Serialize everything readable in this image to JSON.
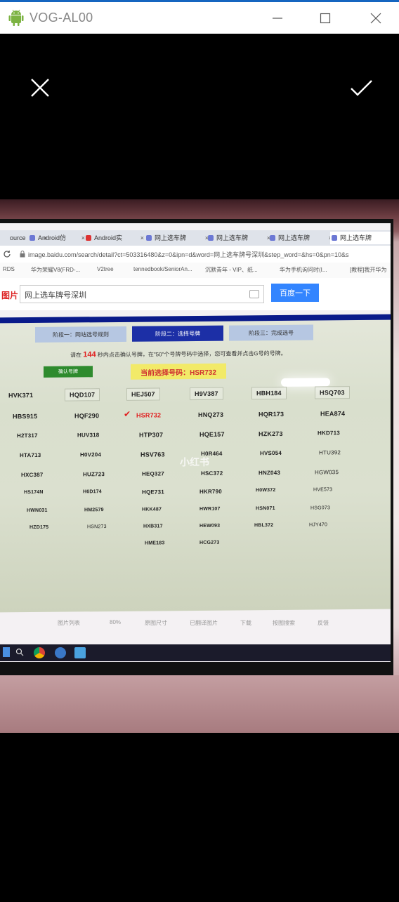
{
  "window": {
    "title": "VOG-AL00",
    "accent_color": "#1565c0",
    "app_icon": "android-icon"
  },
  "camera": {
    "cancel_icon": "close-icon",
    "confirm_icon": "check-icon"
  },
  "browser": {
    "tabs": [
      {
        "label": "ource"
      },
      {
        "label": "Android仿"
      },
      {
        "label": "Android实"
      },
      {
        "label": "网上选车牌"
      },
      {
        "label": "网上选车牌"
      },
      {
        "label": "网上选车牌"
      },
      {
        "label": "网上选车牌"
      }
    ],
    "address": "image.baidu.com/search/detail?ct=503316480&z=0&ipn=d&word=网上选车牌号深圳&step_word=&hs=0&pn=10&s",
    "bookmarks": [
      "RDS",
      "华为荣耀V8(FRD-...",
      "V2tree",
      "tennedbook/SeniorAn...",
      "沉默青年 - VIP、纸...",
      "华为手机询问时(I...",
      "[教程]我开华为"
    ],
    "logo": "图片",
    "search_value": "网上选车牌号深圳",
    "search_button": "百度一下"
  },
  "photo_page": {
    "steps": [
      "阶段一：网站选号规则",
      "阶段二：选择号牌",
      "阶段三：完成选号"
    ],
    "notice_prefix": "请在",
    "notice_count": "144",
    "notice_suffix": "秒内点击确认号牌，在\"50\"个号牌号码中选择，您可查看并点击G号的号牌。",
    "confirm_label": "确认号牌",
    "current_plate": "当前选择号码：HSR732",
    "watermark": "小红书",
    "plates_row1": [
      "HVK371",
      "HQD107",
      "HEJ507",
      "H9V387",
      "HBH184",
      "HSQ703"
    ],
    "plates_row2": [
      "HBS915",
      "HQF290",
      "HSR732",
      "HNQ273",
      "HQR173",
      "HEA874"
    ],
    "plates_row3": [
      "H2T317",
      "HUV318",
      "HTP307",
      "HQE157",
      "HZK273",
      "HKD713"
    ],
    "plates_row4": [
      "HTA713",
      "H0V204",
      "HSV763",
      "H0R464",
      "HVS054",
      "HTU392"
    ],
    "plates_row5": [
      "HXC387",
      "HUZ723",
      "HEQ327",
      "HSC372",
      "HNZ043",
      "HGW035"
    ],
    "plates_row6": [
      "HS174N",
      "H6D174",
      "HQE731",
      "HKR790",
      "H0W372",
      "HVE573"
    ],
    "plates_row7": [
      "HWN031",
      "HM2579",
      "HKK487",
      "HWR107",
      "HSN071",
      "HSG073"
    ],
    "plates_row8": [
      "HZD175",
      "HSN273",
      "HXB317",
      "HEW093",
      "HBL372",
      "HJY470"
    ],
    "plates_row9": [
      "HME183",
      "HCG273"
    ],
    "footer": [
      "图片列表",
      "80%",
      "原图尺寸",
      "已翻译图片",
      "下载",
      "按图搜索",
      "反馈"
    ]
  }
}
